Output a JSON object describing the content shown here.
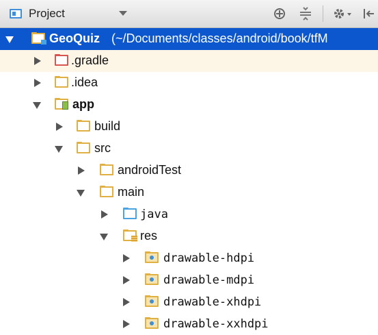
{
  "toolbar": {
    "view_label": "Project",
    "icons": [
      "locate-icon",
      "collapse-all-icon",
      "gear-icon",
      "hide-panel-icon"
    ]
  },
  "tree": {
    "root": "GeoQuiz",
    "root_path": "(~/Documents/classes/android/book/tfM",
    "items": {
      "gradle": ".gradle",
      "idea": ".idea",
      "app": "app",
      "build": "build",
      "src": "src",
      "androidTest": "androidTest",
      "main": "main",
      "java": "java",
      "res": "res",
      "hdpi": "drawable-hdpi",
      "mdpi": "drawable-mdpi",
      "xhdpi": "drawable-xhdpi",
      "xxhdpi": "drawable-xxhdpi"
    }
  },
  "colors": {
    "selection": "#0d57ce",
    "hover": "#fdf5e6"
  }
}
